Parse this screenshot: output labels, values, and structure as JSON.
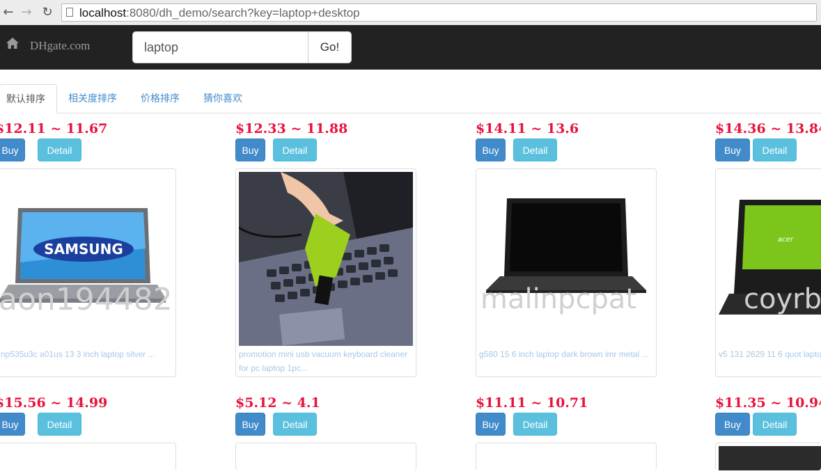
{
  "browser": {
    "url_host": "localhost",
    "url_rest": ":8080/dh_demo/search?key=laptop+desktop"
  },
  "navbar": {
    "brand": "DHgate.com",
    "search_value": "laptop",
    "go_label": "Go!"
  },
  "tabs": [
    {
      "label": "默认排序",
      "active": true
    },
    {
      "label": "相关度排序",
      "active": false
    },
    {
      "label": "价格排序",
      "active": false
    },
    {
      "label": "猜你喜欢",
      "active": false
    }
  ],
  "buttons": {
    "buy": "Buy",
    "detail": "Detail"
  },
  "products": [
    {
      "price": "$12.11 ~ 11.67",
      "title": "np535u3c a01us 13 3 inch laptop silver ...",
      "watermark": "aon194482",
      "image": "samsung-laptop"
    },
    {
      "price": "$12.33 ~ 11.88",
      "title": "promotion mini usb vacuum keyboard cleaner for pc laptop 1pc...",
      "watermark": "",
      "image": "usb-vacuum"
    },
    {
      "price": "$14.11 ~ 13.6",
      "title": "g580 15 6 inch laptop dark brown imr metal ...",
      "watermark": "malinpcpat",
      "image": "black-laptop"
    },
    {
      "price": "$14.36 ~ 13.84",
      "title": "v5 131 2629 11 6 quot lapto",
      "watermark": "coyrb",
      "image": "acer-laptop"
    },
    {
      "price": "$15.56 ~ 14.99",
      "title": "",
      "watermark": "",
      "image": ""
    },
    {
      "price": "$5.12 ~ 4.1",
      "title": "",
      "watermark": "",
      "image": ""
    },
    {
      "price": "$11.11 ~ 10.71",
      "title": "",
      "watermark": "",
      "image": ""
    },
    {
      "price": "$11.35 ~ 10.94",
      "title": "",
      "watermark": "",
      "image": ""
    }
  ],
  "colors": {
    "price": "#e8123c",
    "buy": "#428bca",
    "detail": "#5bc0de",
    "navbar": "#222222"
  }
}
